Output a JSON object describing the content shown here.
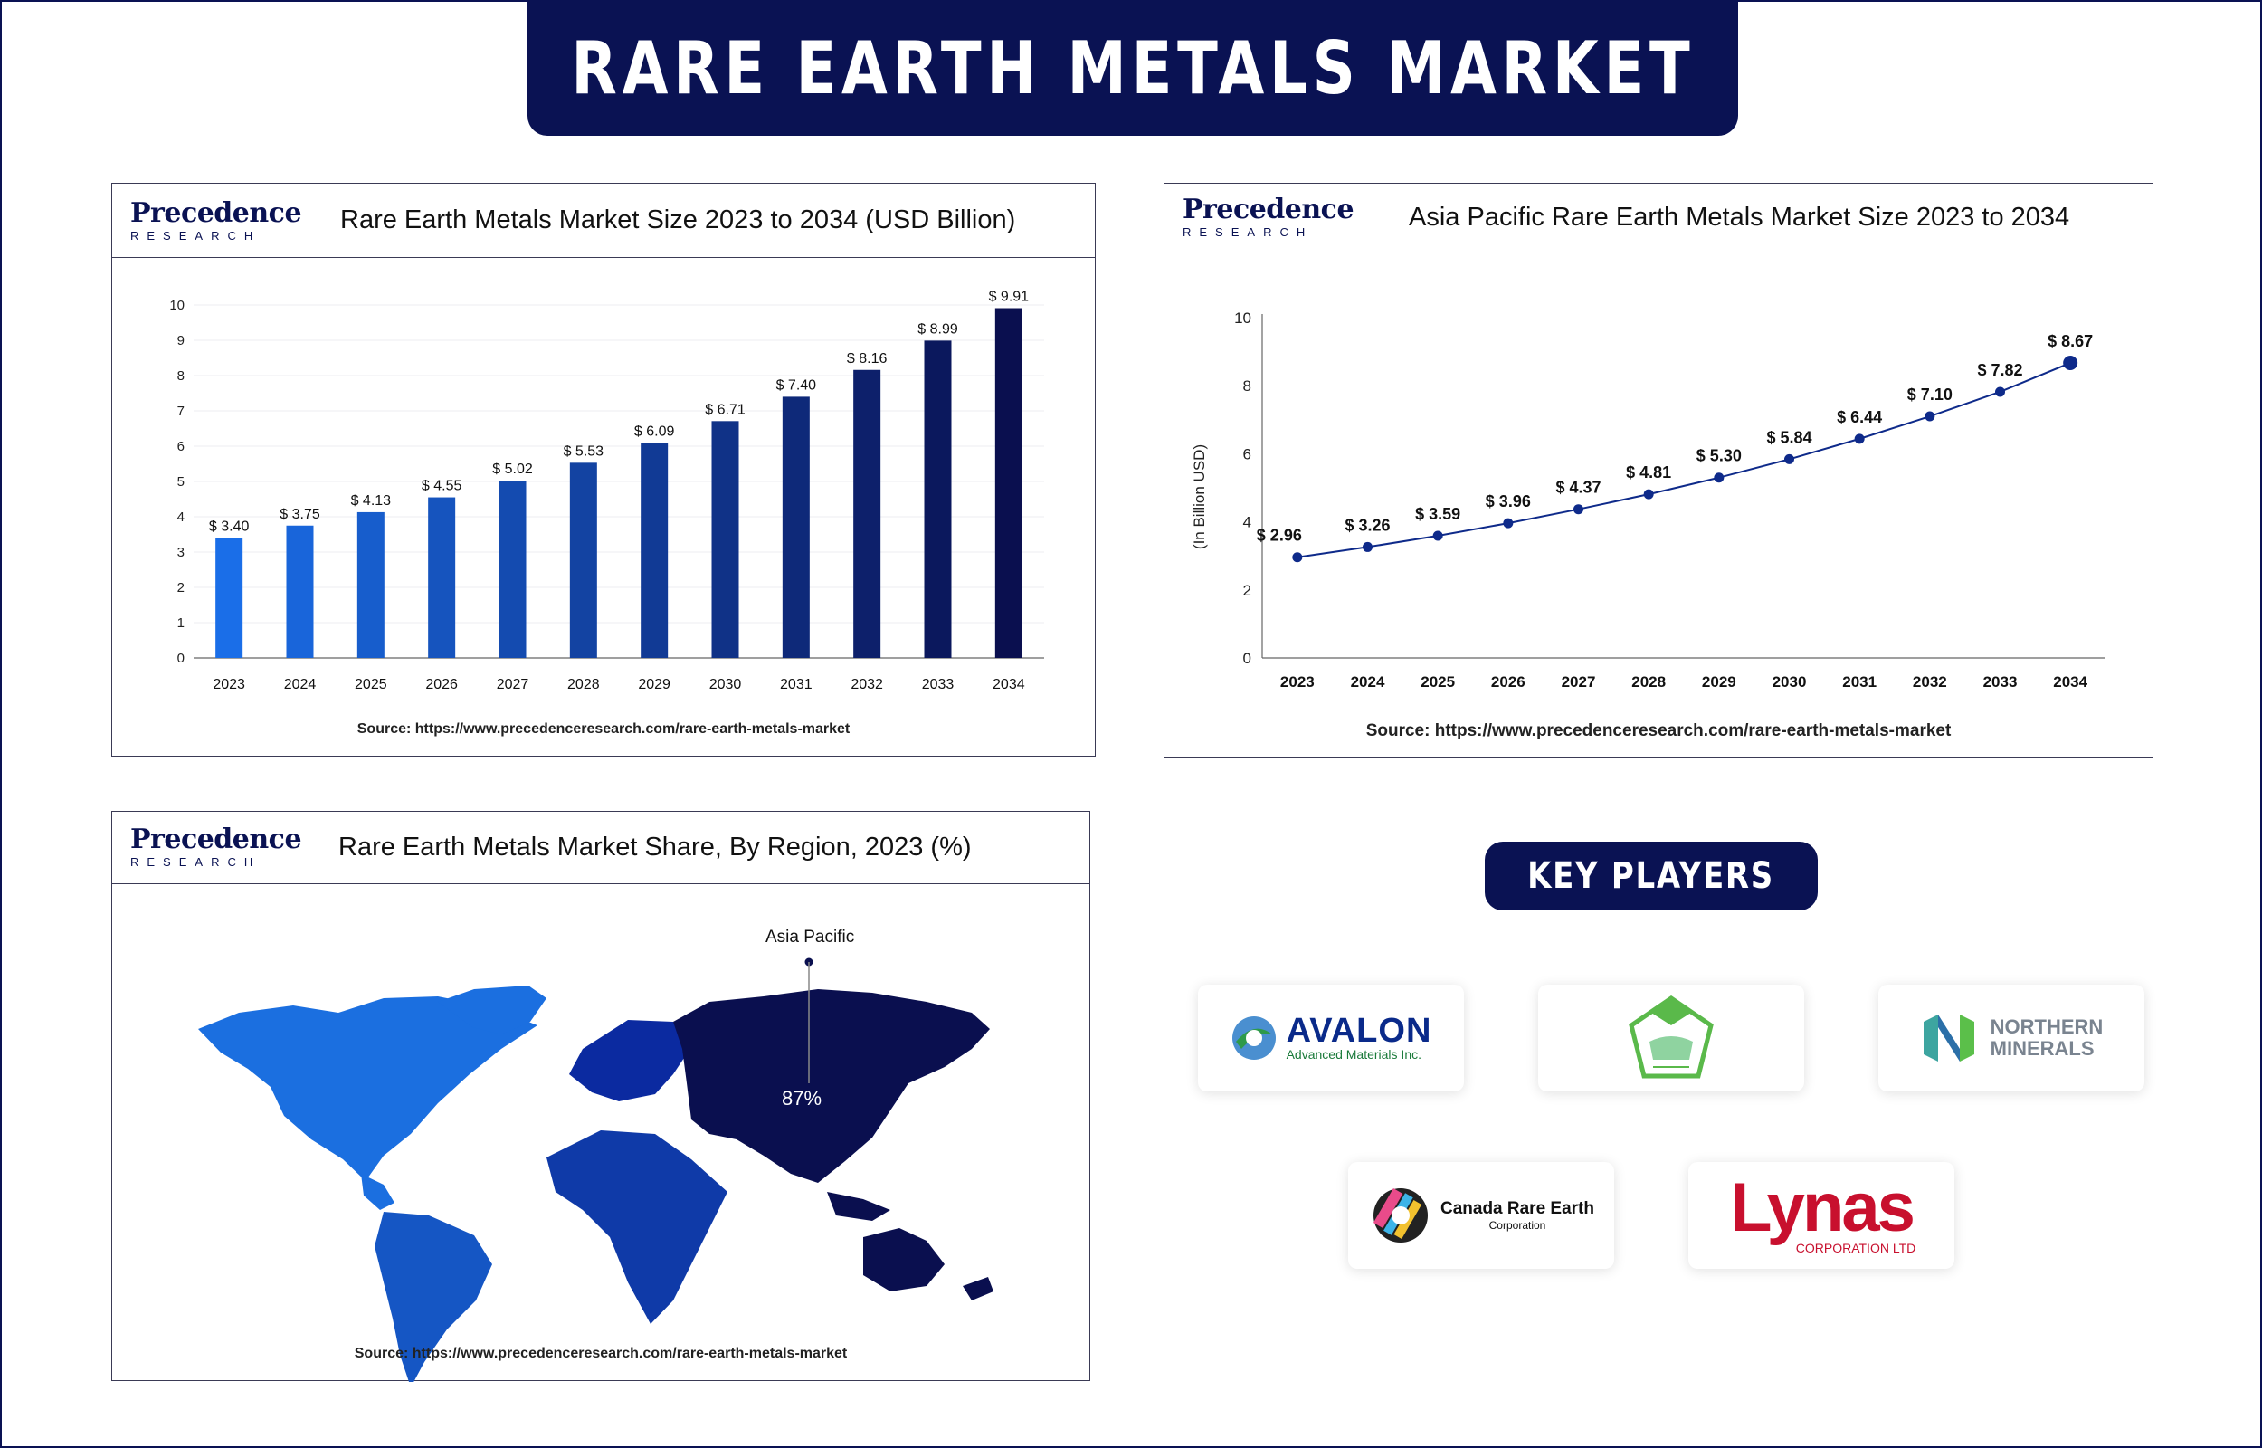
{
  "page": {
    "title": "RARE EARTH METALS MARKET",
    "brand": {
      "logo_word": "Precedence",
      "logo_sub": "RESEARCH",
      "navy": "#0a1253"
    }
  },
  "bar_chart_card": {
    "title": "Rare Earth Metals Market Size 2023 to 2034 (USD Billion)",
    "source": "Source: https://www.precedenceresearch.com/rare-earth-metals-market"
  },
  "line_chart_card": {
    "title": "Asia Pacific Rare Earth Metals Market Size 2023 to 2034",
    "source": "Source: https://www.precedenceresearch.com/rare-earth-metals-market"
  },
  "map_card": {
    "title": "Rare Earth Metals Market Share, By Region, 2023 (%)",
    "source": "Source: https://www.precedenceresearch.com/rare-earth-metals-market",
    "callout_label": "Asia Pacific",
    "callout_value": "87%",
    "colors": {
      "north_america": "#1b6fe0",
      "south_america": "#1556c4",
      "europe": "#0b2aa0",
      "africa": "#0f3aa8",
      "asia_pacific": "#0a0f4f"
    }
  },
  "key_players": {
    "heading": "KEY PLAYERS",
    "players": [
      {
        "name": "AVALON",
        "sub": "Advanced Materials Inc.",
        "color": "#0a2a8a"
      },
      {
        "name": "",
        "sub": "",
        "color": "#5ab94a"
      },
      {
        "name": "NORTHERN",
        "sub": "MINERALS",
        "color": "#7a8490"
      },
      {
        "name": "Canada Rare Earth",
        "sub": "Corporation",
        "color": "#111111"
      },
      {
        "name": "Lynas",
        "sub": "CORPORATION LTD",
        "color": "#c8102e"
      }
    ]
  },
  "chart_data": [
    {
      "type": "bar",
      "categories": [
        "2023",
        "2024",
        "2025",
        "2026",
        "2027",
        "2028",
        "2029",
        "2030",
        "2031",
        "2032",
        "2033",
        "2034"
      ],
      "values": [
        3.4,
        3.75,
        4.13,
        4.55,
        5.02,
        5.53,
        6.09,
        6.71,
        7.4,
        8.16,
        8.99,
        9.91
      ],
      "value_labels": [
        "$ 3.40",
        "$ 3.75",
        "$ 4.13",
        "$ 4.55",
        "$ 5.02",
        "$ 5.53",
        "$ 6.09",
        "$ 6.71",
        "$ 7.40",
        "$ 8.16",
        "$ 8.99",
        "$ 9.91"
      ],
      "yticks": [
        "0",
        "1",
        "2",
        "3",
        "4",
        "5",
        "6",
        "7",
        "8",
        "9",
        "10"
      ],
      "ylim": [
        0,
        10
      ],
      "grid": true,
      "colors": [
        "#1a6ee8",
        "#0a0f4f"
      ]
    },
    {
      "type": "line",
      "x": [
        "2023",
        "2024",
        "2025",
        "2026",
        "2027",
        "2028",
        "2029",
        "2030",
        "2031",
        "2032",
        "2033",
        "2034"
      ],
      "values": [
        2.96,
        3.26,
        3.59,
        3.96,
        4.37,
        4.81,
        5.3,
        5.84,
        6.44,
        7.1,
        7.82,
        8.67
      ],
      "value_labels": [
        "$ 2.96",
        "$ 3.26",
        "$ 3.59",
        "$ 3.96",
        "$ 4.37",
        "$ 4.81",
        "$ 5.30",
        "$ 5.84",
        "$ 6.44",
        "$ 7.10",
        "$ 7.82",
        "$ 8.67"
      ],
      "ylabel": "(In Billion USD)",
      "yticks": [
        "0",
        "2",
        "4",
        "6",
        "8",
        "10"
      ],
      "ylim": [
        0,
        10
      ],
      "grid": false,
      "color": "#0e2a8a"
    }
  ]
}
